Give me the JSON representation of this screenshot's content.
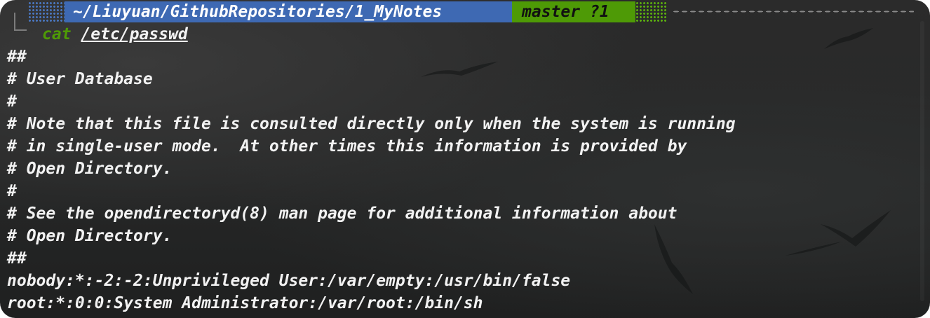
{
  "prompt": {
    "path_prefix": "~/Liuyuan/GithubRepositories/",
    "path_last": "1_MyNotes",
    "git_status": "master ?1"
  },
  "command": {
    "name": "cat",
    "argument": "/etc/passwd"
  },
  "output_lines": [
    "##",
    "# User Database",
    "#",
    "# Note that this file is consulted directly only when the system is running",
    "# in single-user mode.  At other times this information is provided by",
    "# Open Directory.",
    "#",
    "# See the opendirectoryd(8) man page for additional information about",
    "# Open Directory.",
    "##",
    "nobody:*:-2:-2:Unprivileged User:/var/empty:/usr/bin/false",
    "root:*:0:0:System Administrator:/var/root:/bin/sh"
  ],
  "colors": {
    "path_bg": "#3e69b3",
    "git_bg": "#4e9a06",
    "command": "#4e9a06",
    "text": "#f2f2f2"
  }
}
